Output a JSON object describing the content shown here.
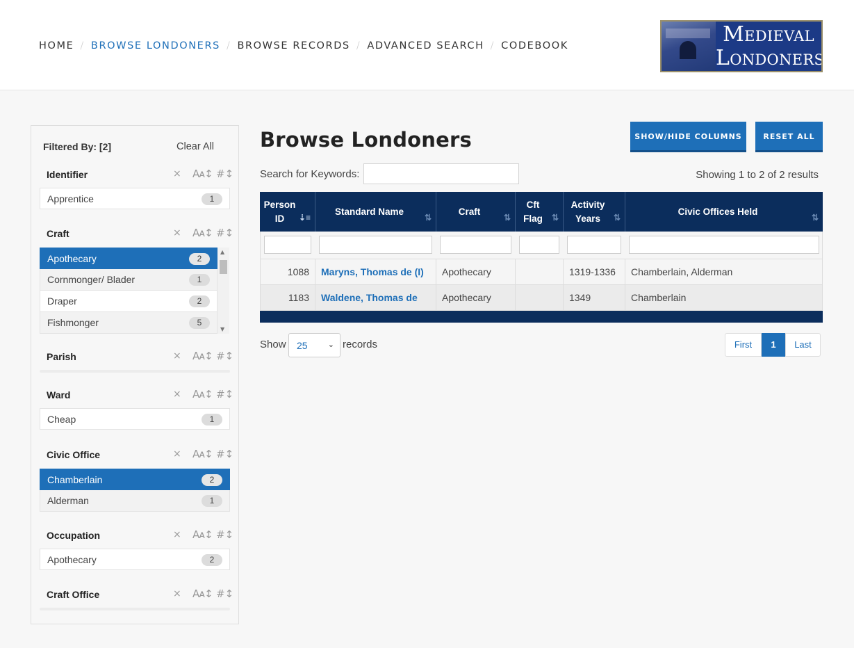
{
  "nav": {
    "items": [
      "HOME",
      "BROWSE LONDONERS",
      "BROWSE RECORDS",
      "ADVANCED SEARCH",
      "CODEBOOK"
    ],
    "active": "BROWSE LONDONERS",
    "separator": "/"
  },
  "logo": {
    "line1": "Medieval",
    "line2": "Londoners"
  },
  "sidebar": {
    "filtered_by": "Filtered By: [2]",
    "clear_all": "Clear All",
    "icons": {
      "clear": "×",
      "sort_alpha": "Aᴀ↕",
      "sort_count": "#↕"
    },
    "facets": {
      "identifier": {
        "title": "Identifier",
        "items": [
          {
            "label": "Apprentice",
            "count": "1"
          }
        ]
      },
      "craft": {
        "title": "Craft",
        "items": [
          {
            "label": "Apothecary",
            "count": "2",
            "selected": true
          },
          {
            "label": "Cornmonger/ Blader",
            "count": "1"
          },
          {
            "label": "Draper",
            "count": "2"
          },
          {
            "label": "Fishmonger",
            "count": "5"
          }
        ]
      },
      "parish": {
        "title": "Parish",
        "items": []
      },
      "ward": {
        "title": "Ward",
        "items": [
          {
            "label": "Cheap",
            "count": "1"
          }
        ]
      },
      "civic_office": {
        "title": "Civic Office",
        "items": [
          {
            "label": "Chamberlain",
            "count": "2",
            "selected": true
          },
          {
            "label": "Alderman",
            "count": "1"
          }
        ]
      },
      "occupation": {
        "title": "Occupation",
        "items": [
          {
            "label": "Apothecary",
            "count": "2"
          }
        ]
      },
      "craft_office": {
        "title": "Craft Office",
        "items": []
      }
    }
  },
  "main": {
    "title": "Browse Londoners",
    "btn_showhide": "SHOW/HIDE COLUMNS",
    "btn_reset": "RESET ALL",
    "search_label": "Search for Keywords:",
    "search_value": "",
    "showing": "Showing 1 to 2 of 2 results",
    "table": {
      "headers": [
        "Person ID",
        "Standard Name",
        "Craft",
        "Cft Flag",
        "Activity Years",
        "Civic Offices Held"
      ],
      "rows": [
        {
          "id": "1088",
          "name": "Maryns, Thomas de (I)",
          "craft": "Apothecary",
          "cft_flag": "",
          "years": "1319-1336",
          "civic": "Chamberlain, Alderman"
        },
        {
          "id": "1183",
          "name": "Waldene, Thomas de",
          "craft": "Apothecary",
          "cft_flag": "",
          "years": "1349",
          "civic": "Chamberlain"
        }
      ]
    },
    "show_label": "Show",
    "page_size": "25",
    "records_label": "records",
    "pager": {
      "first": "First",
      "current": "1",
      "last": "Last"
    }
  }
}
